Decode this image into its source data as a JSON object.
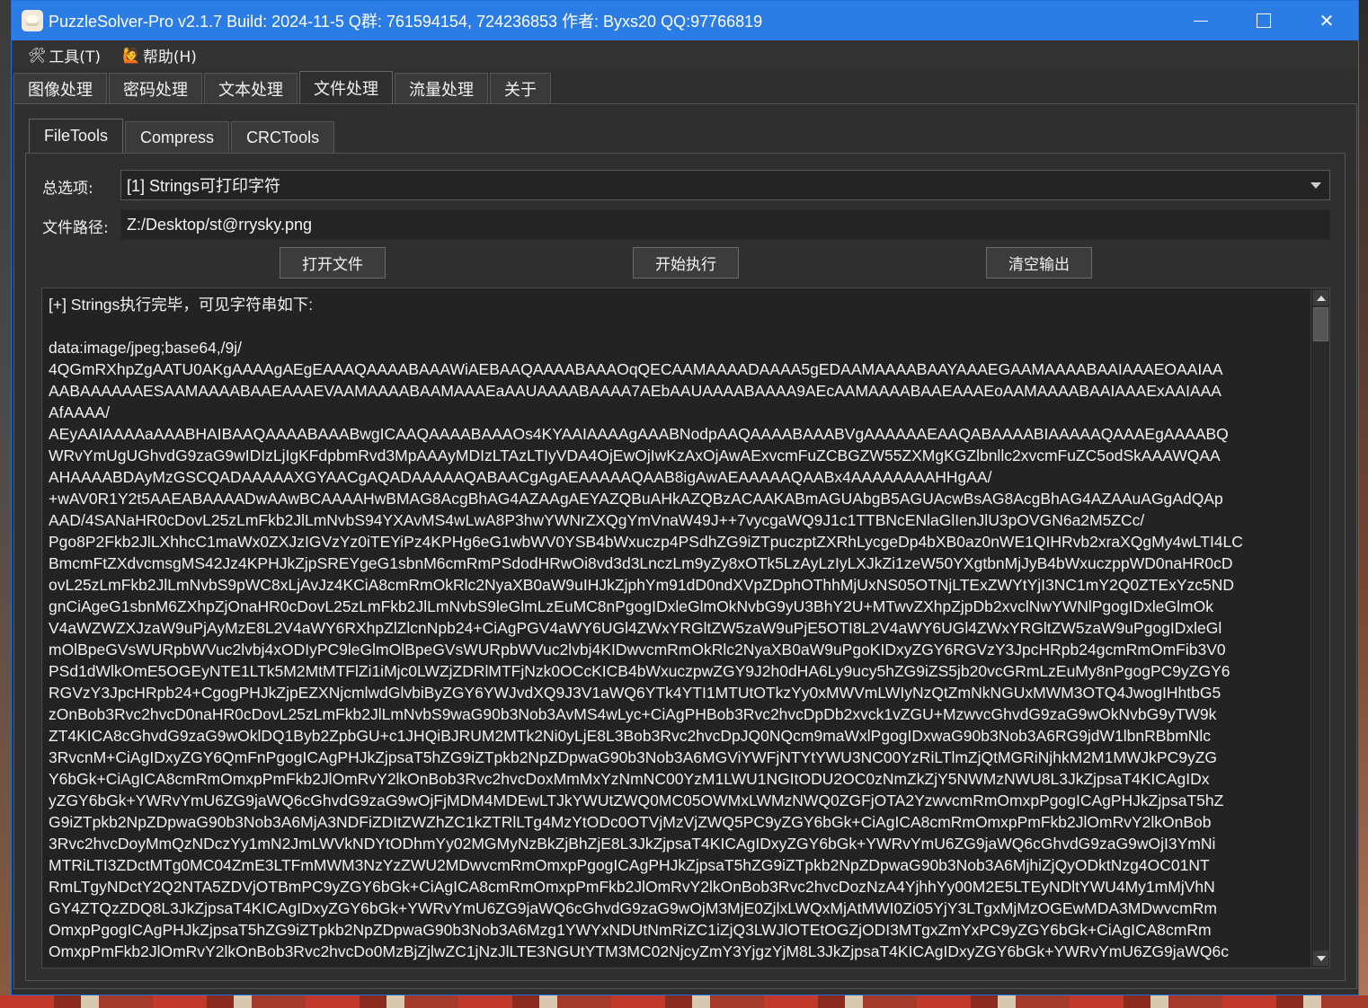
{
  "window": {
    "title": "PuzzleSolver-Pro v2.1.7  Build: 2024-11-5  Q群: 761594154, 724236853  作者: Byxs20  QQ:97766819",
    "controls": {
      "minimize": "",
      "maximize": "",
      "close": "✕"
    }
  },
  "menu": [
    {
      "icon": "🛠",
      "label": "工具(T)"
    },
    {
      "icon": "🙋",
      "label": "帮助(H)"
    }
  ],
  "main_tabs": [
    "图像处理",
    "密码处理",
    "文本处理",
    "文件处理",
    "流量处理",
    "关于"
  ],
  "main_tab_active": "文件处理",
  "sub_tabs": [
    "FileTools",
    "Compress",
    "CRCTools"
  ],
  "sub_tab_active": "FileTools",
  "form": {
    "option_label": "总选项:",
    "option_value": "[1] Strings可打印字符",
    "path_label": "文件路径:",
    "path_value": "Z:/Desktop/st@rrysky.png"
  },
  "buttons": {
    "open": "打开文件",
    "run": "开始执行",
    "clear": "清空输出"
  },
  "output": {
    "lines": [
      "[+] Strings执行完毕，可见字符串如下:",
      "",
      "data:image/jpeg;base64,/9j/",
      "4QGmRXhpZgAATU0AKgAAAAgAEgEAAAQAAAABAAAWiAEBAAQAAAABAAAOqQECAAMAAAADAAAA5gEDAAMAAAABAAYAAAEGAAMAAAABAAIAAAEOAAIAA",
      "AABAAAAAAESAAMAAAABAAEAAAEVAAMAAAABAAMAAAEaAAUAAAABAAAA7AEbAAUAAAABAAAA9AEcAAMAAAABAAEAAAEoAAMAAAABAAIAAAExAAIAAA",
      "AfAAAA/",
      "AEyAAIAAAAaAAABHAIBAAQAAAABAAABwgICAAQAAAABAAAOs4KYAAIAAAAgAAABNodpAAQAAAABAAABVgAAAAAAEAAQABAAAABIAAAAAQAAAEgAAAABQ",
      "WRvYmUgUGhvdG9zaG9wIDIzLjIgKFdpbmRvd3MpAAAyMDIzLTAzLTIyVDA4OjEwOjIwKzAxOjAwAExvcmFuZCBGZW55ZXMgKGZlbnllc2xvcmFuZC5odSkAAAWQAA",
      "AHAAAABDAyMzGSCQADAAAAAXGYAACgAQADAAAAAQABAACgAgAEAAAAAQAAB8igAwAEAAAAAQAABx4AAAAAAAAHHgAA/",
      "+wAV0R1Y2t5AAEABAAAADwAAwBCAAAAHwBMAG8AcgBhAG4AZAAgAEYAZQBuAHkAZQBzACAAKABmAGUAbgB5AGUAcwBsAG8AcgBhAG4AZAAuAGgAdQAp",
      "AAD/4SANaHR0cDovL25zLmFkb2JlLmNvbS94YXAvMS4wLwA8P3hwYWNrZXQgYmVnaW49J++7vycgaWQ9J1c1TTBNcENlaGlIenJlU3pOVGN6a2M5ZCc/",
      "Pgo8P2Fkb2JlLXhhcC1maWx0ZXJzIGVzYz0iTEYiPz4KPHg6eG1wbWV0YSB4bWxuczp4PSdhZG9iZTpuczptZXRhLycgeDp4bXB0az0nWE1QIHRvb2xraXQgMy4wLTI4LC",
      "BmcmFtZXdvcmsgMS42Jz4KPHJkZjpSREYgeG1sbnM6cmRmPSdodHRwOi8vd3d3LnczLm9yZy8xOTk5LzAyLzIyLXJkZi1zeW50YXgtbnMjJyB4bWxuczppWD0naHR0cD",
      "ovL25zLmFkb2JlLmNvbS9pWC8xLjAvJz4KCiA8cmRmOkRlc2NyaXB0aW9uIHJkZjphYm91dD0ndXVpZDphOThhMjUxNS05OTNjLTExZWYtYjI3NC1mY2Q0ZTExYzc5ND",
      "gnCiAgeG1sbnM6ZXhpZjOnaHR0cDovL25zLmFkb2JlLmNvbS9leGlmLzEuMC8nPgogIDxleGlmOkNvbG9yU3BhY2U+MTwvZXhpZjpDb2xvclNwYWNlPgogIDxleGlmOk",
      "V4aWZWZXJzaW9uPjAyMzE8L2V4aWY6RXhpZlZlcnNpb24+CiAgPGV4aWY6UGl4ZWxYRGltZW5zaW9uPjE5OTI8L2V4aWY6UGl4ZWxYRGltZW5zaW9uPgogIDxleGl",
      "mOlBpeGVsWURpbWVuc2lvbj4xODIyPC9leGlmOlBpeGVsWURpbWVuc2lvbj4KIDwvcmRmOkRlc2NyaXB0aW9uPgoKIDxyZGY6RGVzY3JpcHRpb24gcmRmOmFib3V0",
      "PSd1dWlkOmE5OGEyNTE1LTk5M2MtMTFlZi1iMjc0LWZjZDRlMTFjNzk0OCcKICB4bWxuczpwZGY9J2h0dHA6Ly9ucy5hZG9iZS5jb20vcGRmLzEuMy8nPgogPC9yZGY6",
      "RGVzY3JpcHRpb24+CgogPHJkZjpEZXNjcmlwdGlvbiByZGY6YWJvdXQ9J3V1aWQ6YTk4YTI1MTUtOTkzYy0xMWVmLWIyNzQtZmNkNGUxMWM3OTQ4JwogIHhtbG5",
      "zOnBob3Rvc2hvcD0naHR0cDovL25zLmFkb2JlLmNvbS9waG90b3Nob3AvMS4wLyc+CiAgPHBob3Rvc2hvcDpDb2xvck1vZGU+MzwvcGhvdG9zaG9wOkNvbG9yTW9k",
      "ZT4KICA8cGhvdG9zaG9wOklDQ1Byb2ZpbGU+c1JHQiBJRUM2MTk2Ni0yLjE8L3Bob3Rvc2hvcDpJQ0NQcm9maWxlPgogIDxwaG90b3Nob3A6RG9jdW1lbnRBbmNlc",
      "3RvcnM+CiAgIDxyZGY6QmFnPgogICAgPHJkZjpsaT5hZG9iZTpkb2NpZDpwaG90b3Nob3A6MGViYWFjNTYtYWU3NC00YzRiLTlmZjQtMGRiNjhkM2M1MWJkPC9yZG",
      "Y6bGk+CiAgICA8cmRmOmxpPmFkb2JlOmRvY2lkOnBob3Rvc2hvcDoxMmMxYzNmNC00YzM1LWU1NGItODU2OC0zNmZkZjY5NWMzNWU8L3JkZjpsaT4KICAgIDx",
      "yZGY6bGk+YWRvYmU6ZG9jaWQ6cGhvdG9zaG9wOjFjMDM4MDEwLTJkYWUtZWQ0MC05OWMxLWMzNWQ0ZGFjOTA2YzwvcmRmOmxpPgogICAgPHJkZjpsaT5hZ",
      "G9iZTpkb2NpZDpwaG90b3Nob3A6MjA3NDFiZDItZWZhZC1kZTRlLTg4MzYtODc0OTVjMzVjZWQ5PC9yZGY6bGk+CiAgICA8cmRmOmxpPmFkb2JlOmRvY2lkOnBob",
      "3Rvc2hvcDoyMmQzNDczYy1mN2JmLWVkNDYtODhmYy02MGMyNzBkZjBhZjE8L3JkZjpsaT4KICAgIDxyZGY6bGk+YWRvYmU6ZG9jaWQ6cGhvdG9zaG9wOjI3YmNi",
      "MTRiLTI3ZDctMTg0MC04ZmE3LTFmMWM3NzYzZWU2MDwvcmRmOmxpPgogICAgPHJkZjpsaT5hZG9iZTpkb2NpZDpwaG90b3Nob3A6MjhiZjQyODktNzg4OC01NT",
      "RmLTgyNDctY2Q2NTA5ZDVjOTBmPC9yZGY6bGk+CiAgICA8cmRmOmxpPmFkb2JlOmRvY2lkOnBob3Rvc2hvcDozNzA4YjhhYy00M2E5LTEyNDltYWU4My1mMjVhN",
      "GY4ZTQzZDQ8L3JkZjpsaT4KICAgIDxyZGY6bGk+YWRvYmU6ZG9jaWQ6cGhvdG9zaG9wOjM3MjE0ZjlxLWQxMjAtMWI0Zi05YjY3LTgxMjMzOGEwMDA3MDwvcmRm",
      "OmxpPgogICAgPHJkZjpsaT5hZG9iZTpkb2NpZDpwaG90b3Nob3A6Mzg1YWYxNDUtNmRiZC1iZjQ3LWJlOTEtOGZjODI3MTgxZmYxPC9yZGY6bGk+CiAgICA8cmRm",
      "OmxpPmFkb2JlOmRvY2lkOnBob3Rvc2hvcDo0MzBjZjlwZC1jNzJlLTE3NGUtYTM3MC02NjcyZmY3YjgzYjM8L3JkZjpsaT4KICAgIDxyZGY6bGk+YWRvYmU6ZG9jaWQ6c"
    ]
  },
  "colors": {
    "titlebar": "#2b7ce5",
    "window_bg": "#2f2f2f",
    "output_bg": "#232323",
    "text": "#f2f2f2"
  }
}
